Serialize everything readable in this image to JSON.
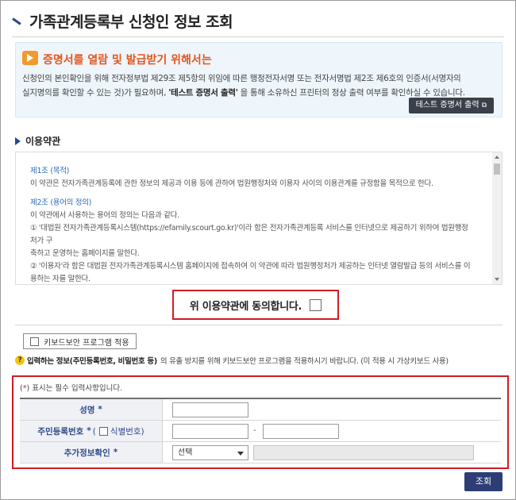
{
  "page": {
    "title": "가족관계등록부 신청인 정보 조회"
  },
  "notice": {
    "icon": "megaphone-icon",
    "title": "증명서를 열람 및 발급받기 위해서는",
    "body_line1": "신청인의 본인확인을 위해 전자정부법 제29조 제5항의 위임에 따른 행정전자서명 또는 전자서명법 제2조 제6호의 인증서(서명자의",
    "body_line2_pre": "실지명의를 확인할 수 있는 것)가 필요하며, ",
    "body_line2_bold": "'테스트 증명서 출력'",
    "body_line2_post": " 을 통해 소유하신 프린터의 정상 출력 여부를 확인하실 수 있습니다.",
    "test_button_label": "테스트 증명서 출력",
    "test_button_icon": "external-link-icon",
    "accent_color": "#e4561b"
  },
  "terms": {
    "section_title": "이용약관",
    "article1_title": "제1조 (목적)",
    "article1_text": "이 약관은 전자가족관계등록에 관한 정보의 제공과 이용 등에 관하여 법원행정처와 이용자 사이의 이용관계를 규정함을 목적으로 한다.",
    "article2_title": "제2조 (용어의 정의)",
    "article2_intro": "이 약관에서 사용하는 용어의 정의는 다음과 같다.",
    "item1_line1": "① '대법원 전자가족관계등록시스템(https://efamily.scourt.go.kr)'이라 함은 전자가족관계등록 서비스를 인터넷으로 제공하기 위하여 법원행정처가 구",
    "item1_line2": "축하고 운영하는 홈페이지를 말한다.",
    "item2_line1": "② '이용자'라 함은 대법원 전자가족관계등록시스템 홈페이지에 접속하여 이 약관에 따라 법원행정처가 제공하는 인터넷 열람발급 등의 서비스를 이",
    "item2_line2": "용하는 자를 말한다."
  },
  "agree": {
    "label": "위 이용약관에 동의합니다.",
    "checked": false
  },
  "keyboard": {
    "button_label": "키보드보안 프로그램 적용",
    "hint_bold": "입력하는 정보(주민등록번호, 비밀번호 등)",
    "hint_text": "의 유출 방지를 위해 키보드보안 프로그램을 적용하시기 바랍니다. (미 적용 시 가상키보드 사용)"
  },
  "form": {
    "required_note_prefix": "(",
    "required_note_star": "*",
    "required_note_suffix": ") 표시는 필수 입력사항입니다.",
    "name_label": "성명",
    "rrn_label": "주민등록번호",
    "rrn_id_label": "식별번호)",
    "rrn_open_paren": "(",
    "rrn_dash": "-",
    "extra_label": "추가정보확인",
    "extra_select_value": "선택",
    "star": "*"
  },
  "actions": {
    "submit_label": "조회"
  }
}
